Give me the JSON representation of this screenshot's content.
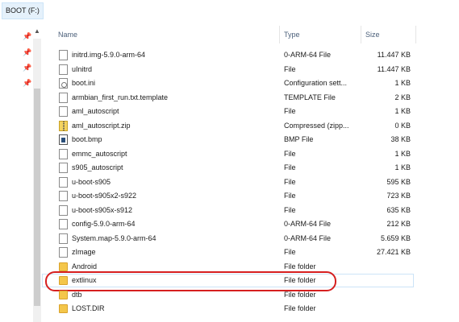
{
  "address": {
    "crumb": "BOOT (F:)"
  },
  "columns": {
    "name": "Name",
    "type": "Type",
    "size": "Size"
  },
  "files": [
    {
      "name": "initrd.img-5.9.0-arm-64",
      "type": "0-ARM-64 File",
      "size": "11.447 KB",
      "icon": "file"
    },
    {
      "name": "uInitrd",
      "type": "File",
      "size": "11.447 KB",
      "icon": "file"
    },
    {
      "name": "boot.ini",
      "type": "Configuration sett...",
      "size": "1 KB",
      "icon": "ini"
    },
    {
      "name": "armbian_first_run.txt.template",
      "type": "TEMPLATE File",
      "size": "2 KB",
      "icon": "file"
    },
    {
      "name": "aml_autoscript",
      "type": "File",
      "size": "1 KB",
      "icon": "file"
    },
    {
      "name": "aml_autoscript.zip",
      "type": "Compressed (zipp...",
      "size": "0 KB",
      "icon": "zip"
    },
    {
      "name": "boot.bmp",
      "type": "BMP File",
      "size": "38 KB",
      "icon": "bmp"
    },
    {
      "name": "emmc_autoscript",
      "type": "File",
      "size": "1 KB",
      "icon": "file"
    },
    {
      "name": "s905_autoscript",
      "type": "File",
      "size": "1 KB",
      "icon": "file"
    },
    {
      "name": "u-boot-s905",
      "type": "File",
      "size": "595 KB",
      "icon": "file"
    },
    {
      "name": "u-boot-s905x2-s922",
      "type": "File",
      "size": "723 KB",
      "icon": "file"
    },
    {
      "name": "u-boot-s905x-s912",
      "type": "File",
      "size": "635 KB",
      "icon": "file"
    },
    {
      "name": "config-5.9.0-arm-64",
      "type": "0-ARM-64 File",
      "size": "212 KB",
      "icon": "file"
    },
    {
      "name": "System.map-5.9.0-arm-64",
      "type": "0-ARM-64 File",
      "size": "5.659 KB",
      "icon": "file"
    },
    {
      "name": "zImage",
      "type": "File",
      "size": "27.421 KB",
      "icon": "file"
    },
    {
      "name": "Android",
      "type": "File folder",
      "size": "",
      "icon": "folder"
    },
    {
      "name": "extlinux",
      "type": "File folder",
      "size": "",
      "icon": "folder",
      "highlighted": true
    },
    {
      "name": "dtb",
      "type": "File folder",
      "size": "",
      "icon": "folder"
    },
    {
      "name": "LOST.DIR",
      "type": "File folder",
      "size": "",
      "icon": "folder"
    }
  ],
  "colors": {
    "highlight_ring": "#d61f1f",
    "folder": "#f4c64a",
    "header_text": "#4c607a"
  }
}
